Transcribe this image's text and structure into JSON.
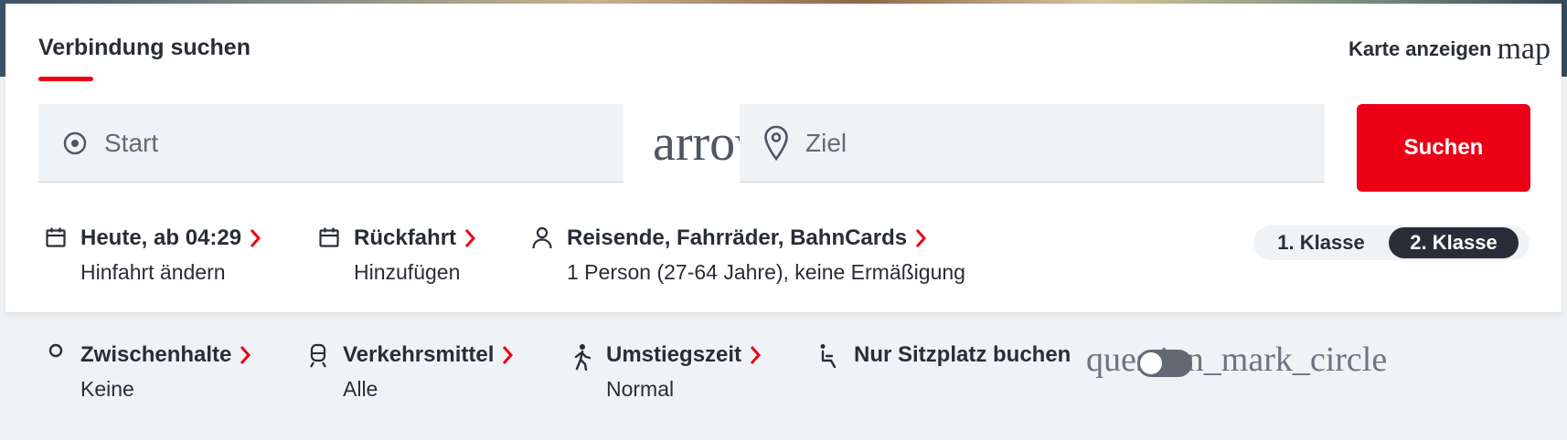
{
  "header": {
    "title": "Verbindung suchen",
    "map_link_label": "Karte anzeigen",
    "map_icon_text": "map"
  },
  "search": {
    "start_placeholder": "Start",
    "swap_icon_text": "arrow",
    "ziel_placeholder": "Ziel",
    "button_label": "Suchen"
  },
  "options": {
    "outbound": {
      "title": "Heute, ab 04:29",
      "sub": "Hinfahrt ändern",
      "icon": "calendar-icon"
    },
    "return": {
      "title": "Rückfahrt",
      "sub": "Hinzufügen",
      "icon": "calendar-icon"
    },
    "travellers": {
      "title": "Reisende, Fahrräder, BahnCards",
      "sub": "1 Person (27-64 Jahre), keine Ermäßigung",
      "icon": "person-icon"
    }
  },
  "travel_class": {
    "first": "1. Klasse",
    "second": "2. Klasse",
    "selected": "second"
  },
  "more_options": {
    "stops": {
      "title": "Zwischenhalte",
      "sub": "Keine",
      "icon": "stop-icon"
    },
    "transport": {
      "title": "Verkehrsmittel",
      "sub": "Alle",
      "icon": "train-icon"
    },
    "transfer": {
      "title": "Umstiegszeit",
      "sub": "Normal",
      "icon": "walking-icon"
    },
    "seat_only": {
      "title": "Nur Sitzplatz buchen",
      "icon": "seat-icon",
      "help_icon_text": "question_mark_circle",
      "toggle_on": false
    }
  },
  "colors": {
    "accent": "#ec0016",
    "text": "#282d37",
    "field_bg": "#f0f3f5",
    "selected_class_bg": "#282d37"
  }
}
